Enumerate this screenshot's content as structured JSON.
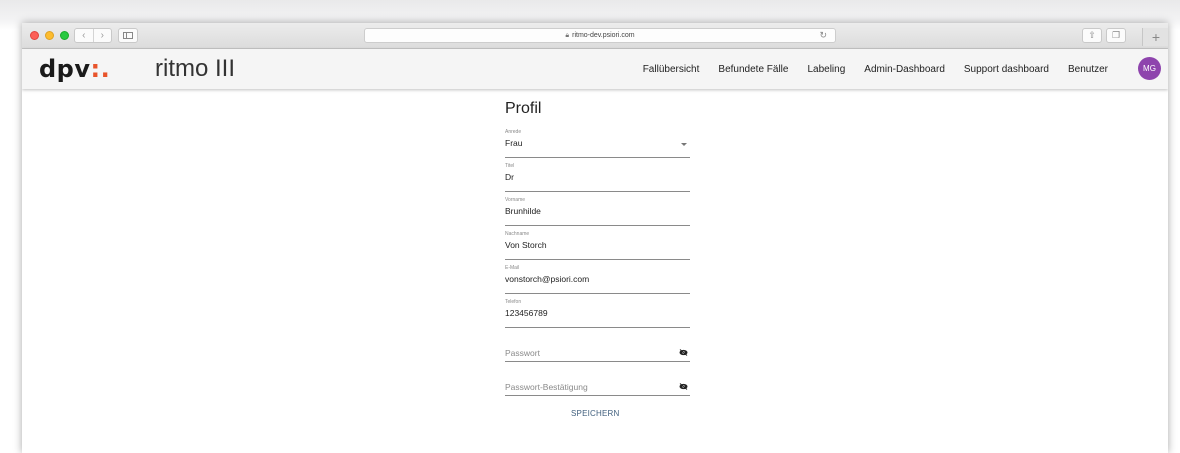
{
  "browser": {
    "url": "ritmo-dev.psiori.com"
  },
  "header": {
    "logo_text": "dpv",
    "logo_dots": ":.",
    "product_name": "ritmo III",
    "nav": [
      "Fallübersicht",
      "Befundete Fälle",
      "Labeling",
      "Admin-Dashboard",
      "Support dashboard",
      "Benutzer"
    ],
    "avatar_initials": "MG",
    "avatar_color": "#8e44ad"
  },
  "form": {
    "title": "Profil",
    "anrede": {
      "label": "Anrede",
      "value": "Frau"
    },
    "titel": {
      "label": "Titel",
      "value": "Dr"
    },
    "vorname": {
      "label": "Vorname",
      "value": "Brunhilde"
    },
    "nachname": {
      "label": "Nachname",
      "value": "Von Storch"
    },
    "email": {
      "label": "E-Mail",
      "value": "vonstorch@psiori.com"
    },
    "telefon": {
      "label": "Telefon",
      "value": "123456789"
    },
    "passwort": {
      "placeholder": "Passwort"
    },
    "passwort_bestaetigung": {
      "placeholder": "Passwort-Bestätigung"
    },
    "save_label": "SPEICHERN"
  },
  "colors": {
    "accent_link": "#41607e",
    "logo_dots": "#e8542b"
  }
}
